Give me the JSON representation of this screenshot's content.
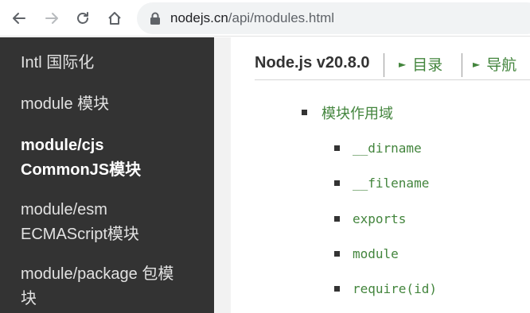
{
  "browser": {
    "url_host": "nodejs.cn",
    "url_path": "/api/modules.html"
  },
  "sidebar": {
    "items": [
      {
        "label": "Intl 国际化"
      },
      {
        "label": "module 模块"
      },
      {
        "label_line1": "module/cjs",
        "label_line2": "CommonJS模块",
        "active": true
      },
      {
        "label_line1": "module/esm",
        "label_line2": "ECMAScript模块"
      },
      {
        "label_line1": "module/package 包模",
        "label_line2": "块"
      }
    ]
  },
  "header": {
    "version": "Node.js v20.8.0",
    "toc_label": "目录",
    "nav_label": "导航"
  },
  "toc": {
    "section": "模块作用域",
    "items": [
      "__dirname",
      "__filename",
      "exports",
      "module",
      "require(id)"
    ]
  },
  "colors": {
    "sidebar_bg": "#333333",
    "link_green": "#43853d",
    "text_dark": "#333333"
  }
}
